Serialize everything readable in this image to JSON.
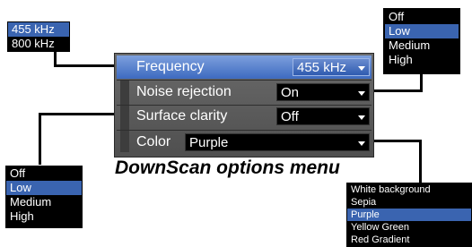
{
  "freq_popup": {
    "options": [
      "455 kHz",
      "800 kHz"
    ],
    "selected_index": -1
  },
  "top_right_popup": {
    "options": [
      "Off",
      "Low",
      "Medium",
      "High"
    ],
    "selected_index": 1
  },
  "bottom_left_popup": {
    "options": [
      "Off",
      "Low",
      "Medium",
      "High"
    ],
    "selected_index": 1
  },
  "color_popup": {
    "options": [
      "White background",
      "Sepia",
      "Purple",
      "Yellow Green",
      "Red Gradient"
    ],
    "selected_index": 2
  },
  "panel": {
    "frequency": {
      "label": "Frequency",
      "value": "455 kHz"
    },
    "noise_rejection": {
      "label": "Noise rejection",
      "value": "On"
    },
    "surface_clarity": {
      "label": "Surface clarity",
      "value": "Off"
    },
    "color": {
      "label": "Color",
      "value": "Purple"
    }
  },
  "caption": "DownScan options menu",
  "colors": {
    "highlight": "#3a64b0",
    "panel_bg": "#5a5a5a"
  }
}
